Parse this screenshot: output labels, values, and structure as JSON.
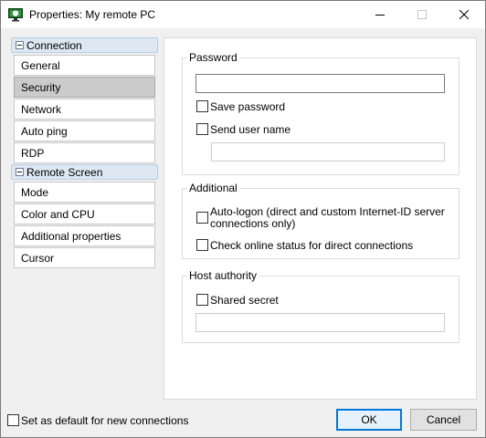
{
  "window": {
    "title": "Properties: My remote PC"
  },
  "sidebar": {
    "groups": [
      {
        "label": "Connection",
        "items": [
          "General",
          "Security",
          "Network",
          "Auto ping",
          "RDP"
        ]
      },
      {
        "label": "Remote Screen",
        "items": [
          "Mode",
          "Color and CPU",
          "Additional properties",
          "Cursor"
        ]
      }
    ],
    "selected": "Security"
  },
  "password_group": {
    "legend": "Password",
    "password_value": "",
    "save_password": {
      "label": "Save password",
      "checked": false
    },
    "send_user_name": {
      "label": "Send user name",
      "checked": false
    },
    "user_name_value": ""
  },
  "additional_group": {
    "legend": "Additional",
    "auto_logon": {
      "label_line1": "Auto-logon (direct and custom Internet-ID server",
      "label_line2": "connections only)",
      "checked": false
    },
    "check_online": {
      "label": "Check online status for direct connections",
      "checked": false
    }
  },
  "host_group": {
    "legend": "Host authority",
    "shared_secret": {
      "label": "Shared secret",
      "checked": false
    },
    "secret_value": ""
  },
  "footer": {
    "default_checkbox": {
      "label": "Set as default for new connections",
      "checked": false
    },
    "ok_label": "OK",
    "cancel_label": "Cancel"
  },
  "icons": {
    "app": "shield-monitor-icon",
    "minimize": "minimize-icon",
    "maximize": "maximize-icon",
    "close": "close-icon"
  },
  "colors": {
    "accent": "#0078d7",
    "selected_item": "#cbcbcb",
    "group_header": "#dde8f3"
  }
}
